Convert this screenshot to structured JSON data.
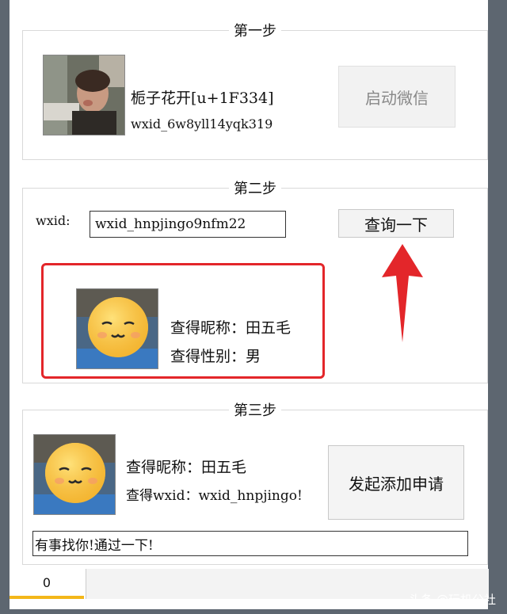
{
  "step1": {
    "title": "第一步",
    "nickname": "栀子花开[u+1F334]",
    "wxid": "wxid_6w8yll14yqk319",
    "launch_button": "启动微信"
  },
  "step2": {
    "title": "第二步",
    "wxid_label": "wxid:",
    "wxid_value": "wxid_hnpjingo9nfm22",
    "query_button": "查询一下",
    "result_nickname": "查得昵称：田五毛",
    "result_gender": "查得性别：男",
    "highlight_color": "#e3262a"
  },
  "step3": {
    "title": "第三步",
    "nickname": "查得昵称：田五毛",
    "wxid_line": "查得wxid：wxid_hnpjingo!",
    "add_button": "发起添加申请",
    "message_value": "有事找你!通过一下!"
  },
  "status": {
    "value": "0"
  },
  "watermark": "头条 @玩机公社"
}
